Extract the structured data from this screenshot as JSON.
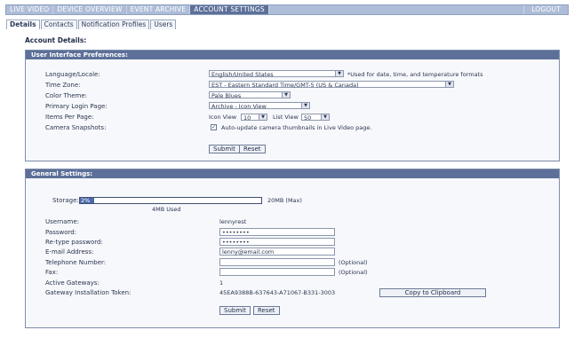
{
  "topnav": {
    "tabs": [
      "LIVE VIDEO",
      "DEVICE OVERVIEW",
      "EVENT ARCHIVE",
      "ACCOUNT SETTINGS"
    ],
    "active_index": 3,
    "logout_label": "LOGOUT"
  },
  "subtabs": {
    "tabs": [
      "Details",
      "Contacts",
      "Notification Profiles",
      "Users"
    ],
    "active_index": 0
  },
  "page_title": "Account Details:",
  "ui_prefs": {
    "header": "User Interface Preferences:",
    "language_label": "Language/Locale:",
    "language_value": "English/United States",
    "language_note": "*Used for date, time, and temperature formats",
    "timezone_label": "Time Zone:",
    "timezone_value": "EST - Eastern Standard Time/GMT-5 (US & Canada)",
    "color_label": "Color Theme:",
    "color_value": "Pale Blues",
    "login_page_label": "Primary Login Page:",
    "login_page_value": "Archive - Icon View",
    "items_label": "Items Per Page:",
    "icon_view_label": "Icon View",
    "icon_view_value": "10",
    "list_view_label": "List View",
    "list_view_value": "50",
    "snapshots_label": "Camera Snapshots:",
    "snapshots_checked": true,
    "snapshots_text": "Auto-update camera thumbnails in Live Video page.",
    "submit_label": "Submit",
    "reset_label": "Reset"
  },
  "general": {
    "header": "General Settings:",
    "storage_label": "Storage:",
    "storage_percent": "2%",
    "storage_fraction": 0.02,
    "storage_max": "20MB (Max)",
    "storage_used": "4MB Used",
    "username_label": "Username:",
    "username_value": "lennyrest",
    "password_label": "Password:",
    "password_value": "••••••••",
    "retype_label": "Re-type password:",
    "retype_value": "••••••••",
    "email_label": "E-mail Address:",
    "email_value": "lenny@email.com",
    "phone_label": "Telephone Number:",
    "phone_value": "",
    "phone_note": "(Optional)",
    "fax_label": "Fax:",
    "fax_value": "",
    "fax_note": "(Optional)",
    "gateways_label": "Active Gateways:",
    "gateways_value": "1",
    "token_label": "Gateway Installation Token:",
    "token_value": "45EA9388B-637643-A71067-B331-3003",
    "copy_label": "Copy to Clipboard",
    "submit_label": "Submit",
    "reset_label": "Reset"
  }
}
